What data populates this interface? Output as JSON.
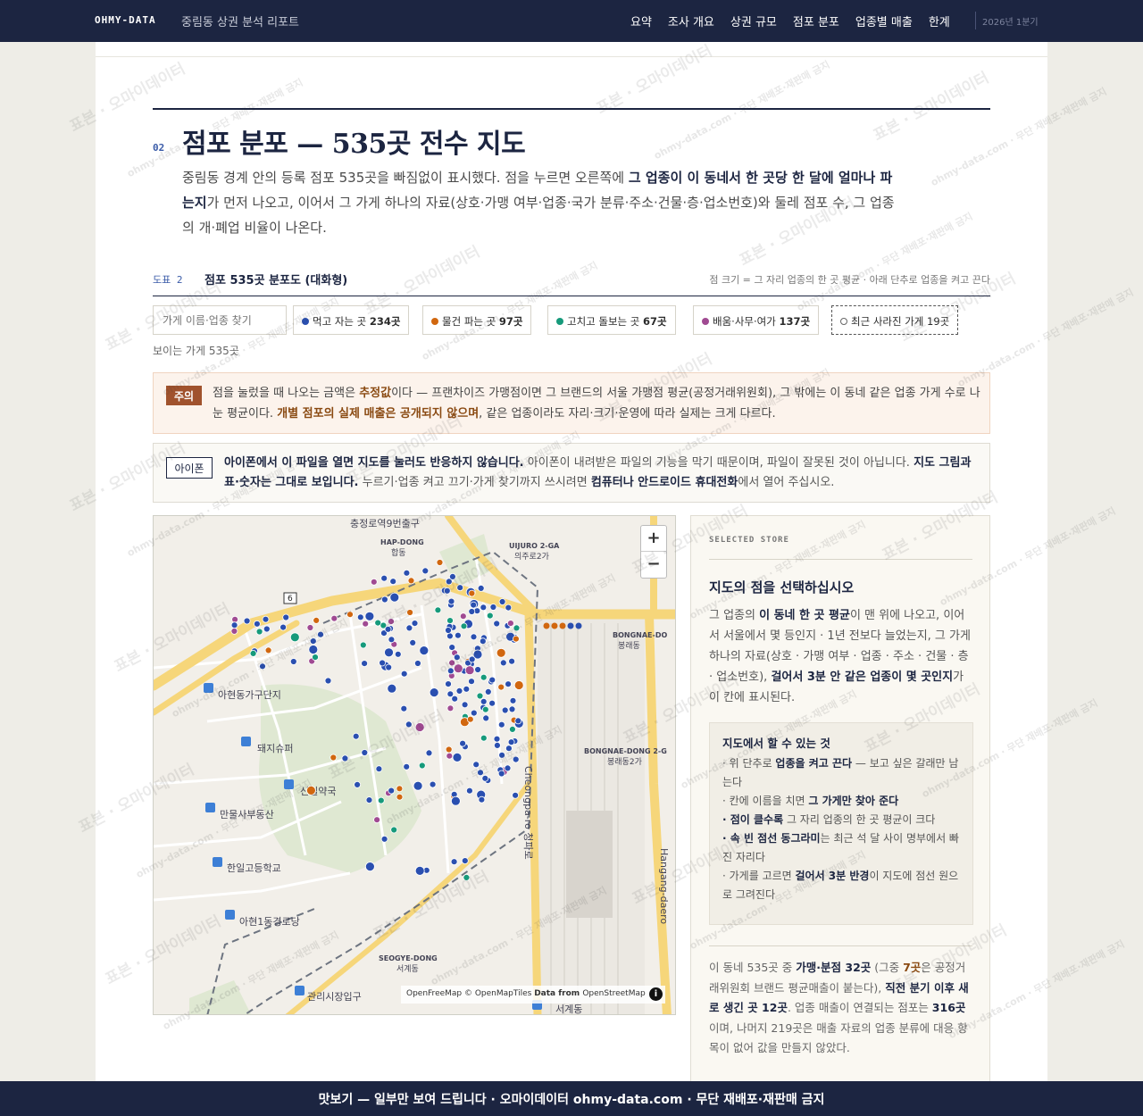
{
  "nav": {
    "brand": "OHMY-DATA",
    "subtitle": "중림동 상권 분석 리포트",
    "menu": [
      "요약",
      "조사 개요",
      "상권 규모",
      "점포 분포",
      "업종별 매출",
      "한계"
    ],
    "period": "2026년 1분기"
  },
  "section": {
    "number": "02",
    "title": "점포 분포 — 535곳 전수 지도",
    "lead_1": "중림동 경계 안의 등록 점포 535곳을 빠짐없이 표시했다. 점을 누르면 오른쪽에 ",
    "lead_bold": "그 업종이 이 동네서 한 곳당 한 달에 얼마나 파는지",
    "lead_2": "가 먼저 나오고, 이어서 그 가게 하나의 자료(상호·가맹 여부·업종·국가 분류·주소·건물·층·업소번호)와 둘레 점포 수, 그 업종의 개·폐업 비율이 나온다."
  },
  "figure": {
    "label": "도표 2",
    "title": "점포 535곳 분포도 (대화형)",
    "note": "점 크기 = 그 자리 업종의 한 곳 평균 · 아래 단추로 업종을 켜고 끈다"
  },
  "filters": {
    "search_placeholder": "가게 이름·업종 찾기",
    "chips": [
      {
        "label": "먹고 자는 곳",
        "count": "234곳",
        "color": "#2a4fb0"
      },
      {
        "label": "물건 파는 곳",
        "count": "97곳",
        "color": "#d1670f"
      },
      {
        "label": "고치고 돌보는 곳",
        "count": "67곳",
        "color": "#169a7b"
      },
      {
        "label": "배움·사무·여가",
        "count": "137곳",
        "color": "#a04a92"
      }
    ],
    "closed_label": "최근 사라진 가게 19곳",
    "visible_count": "보이는 가게 535곳"
  },
  "notice": {
    "badge": "주의",
    "t1": "점을 눌렀을 때 나오는 금액은 ",
    "b1": "추정값",
    "t2": "이다 — 프랜차이즈 가맹점이면 그 브랜드의 서울 가맹점 평균(공정거래위원회), 그 밖에는 이 동네 같은 업종 가게 수로 나눈 평균이다. ",
    "b2": "개별 점포의 실제 매출은 공개되지 않으며",
    "t3": ", 같은 업종이라도 자리·크기·운영에 따라 실제는 크게 다르다."
  },
  "ios": {
    "badge": "아이폰",
    "b1": "아이폰에서 이 파일을 열면 지도를 눌러도 반응하지 않습니다.",
    "t1": " 아이폰이 내려받은 파일의 기능을 막기 때문이며, 파일이 잘못된 것이 아닙니다. ",
    "b2": "지도 그림과 표·숫자는 그대로 보입니다.",
    "t2": " 누르기·업종 켜고 끄기·가게 찾기까지 쓰시려면 ",
    "b3": "컴퓨터나 안드로이드 휴대전화",
    "t3": "에서 열어 주십시오."
  },
  "map": {
    "zoom_in": "+",
    "zoom_out": "−",
    "attribution_1": "OpenFreeMap © OpenMapTiles ",
    "attribution_2": "Data from ",
    "attribution_3": "OpenStreetMap",
    "info": "i",
    "labels": {
      "chungjeongno": "충정로역9번출구",
      "hapdong_en": "HAP-DONG",
      "hapdong_ko": "합동",
      "uijuro_en": "UIJURO 2-GA",
      "uijuro_ko": "의주로2가",
      "bongnae_en": "BONGNAE-DO",
      "bongnae_ko": "봉래동",
      "bongnae2_en": "BONGNAE-DONG 2-G",
      "bongnae2_ko": "봉래동2가",
      "ahyeon_apt": "아현동가구단지",
      "mart": "돼지슈퍼",
      "pharmacy": "신일약국",
      "realty": "만물사부동산",
      "school": "한일고등학교",
      "ahyeon_cross": "아현1동경로당",
      "seogye_en": "SEOGYE-DONG",
      "seogye_ko": "서계동",
      "market": "관리시장입구",
      "cheongpa": "Cheongpa-ro 청파로",
      "hangang": "Hangang-daero",
      "seogye_bottom": "서계동",
      "road_no": "6"
    }
  },
  "side": {
    "label": "SELECTED STORE",
    "title": "지도의 점을 선택하십시오",
    "d1": "그 업종의 ",
    "db1": "이 동네 한 곳 평균",
    "d2": "이 맨 위에 나오고, 이어서 서울에서 몇 등인지 · 1년 전보다 늘었는지, 그 가게 하나의 자료(상호 · 가맹 여부 · 업종 · 주소 · 건물 · 층 · 업소번호), ",
    "db2": "걸어서 3분 안 같은 업종이 몇 곳인지",
    "d3": "가 이 칸에 표시된다.",
    "help_title": "지도에서 할 수 있는 것",
    "h1_pre": "· 위 단추로 ",
    "h1_b": "업종을 켜고 끈다",
    "h1_post": " — 보고 싶은 갈래만 남는다",
    "h2_pre": "· 칸에 이름을 치면 ",
    "h2_b": "그 가게만 찾아 준다",
    "h3_b": "· 점이 클수록",
    "h3_post": " 그 자리 업종의 한 곳 평균이 크다",
    "h4_b": "· 속 빈 점선 동그라미",
    "h4_post": "는 최근 석 달 사이 명부에서 빠진 자리다",
    "h5_pre": "· 가게를 고르면 ",
    "h5_b": "걸어서 3분 반경",
    "h5_post": "이 지도에 점선 원으로 그려진다",
    "f1": "이 동네 535곳 중 ",
    "fb1": "가맹·분점 32곳",
    "f2": " (그중 ",
    "fh": "7곳",
    "f3": "은 공정거래위원회 브랜드 평균매출이 붙는다), ",
    "fb2": "직전 분기 이후 새로 생긴 곳 12곳",
    "f4": ". 업종 매출이 연결되는 점포는 ",
    "fb3": "316곳",
    "f5": "이며, 나머지 219곳은 매출 자료의 업종 분류에 대응 항목이 없어 값을 만들지 않았다."
  },
  "banner": "맛보기 — 일부만 보여 드립니다 · 오마이데이터 ohmy-data.com · 무단 재배포·재판매 금지",
  "watermark": {
    "main": "표본 · 오마이데이터",
    "sub": "ohmy-data.com · 무단 재배포·재판매 금지"
  },
  "colors": {
    "navy": "#1c2541",
    "eat": "#2a4fb0",
    "shop": "#d1670f",
    "care": "#169a7b",
    "learn": "#a04a92"
  }
}
